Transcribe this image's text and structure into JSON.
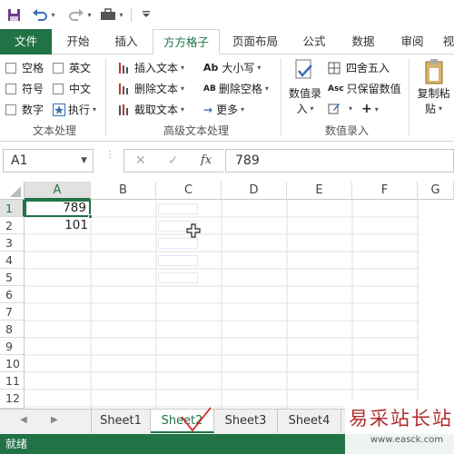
{
  "quick_access": {
    "save_icon": "save-icon",
    "undo_icon": "undo-icon",
    "redo_icon": "redo-icon",
    "custom_icon": "toolbox-icon",
    "dropdown_icon": "chevron-down-icon"
  },
  "tabs": [
    "文件",
    "开始",
    "插入",
    "方方格子",
    "页面布局",
    "公式",
    "数据",
    "审阅",
    "视"
  ],
  "ribbon": {
    "text_processing": {
      "label": "文本处理",
      "checkboxes": [
        "空格",
        "英文",
        "符号",
        "中文",
        "数字"
      ],
      "execute": "执行"
    },
    "advanced_text": {
      "label": "高级文本处理",
      "insert_text": "插入文本",
      "delete_text": "删除文本",
      "extract_text": "截取文本",
      "case": "大小写",
      "case_icon": "Ab",
      "delete_space": "删除空格",
      "delete_space_icon": "AB",
      "more": "更多"
    },
    "number_entry": {
      "label": "数值录入",
      "number_entry_btn": "数值录",
      "number_entry_btn2": "入",
      "round": "四舍五入",
      "keep_value": "只保留数值",
      "keep_value_icon": "Asc",
      "plus": "+"
    },
    "copy_paste": {
      "line1": "复制粘",
      "line2": "贴"
    }
  },
  "formula_bar": {
    "name_box": "A1",
    "cancel": "✕",
    "confirm": "✓",
    "fx": "fx",
    "value": "789"
  },
  "grid": {
    "columns": [
      "A",
      "B",
      "C",
      "D",
      "E",
      "F",
      "G"
    ],
    "rows": [
      "1",
      "2",
      "3",
      "4",
      "5",
      "6",
      "7",
      "8",
      "9",
      "10",
      "11",
      "12"
    ],
    "cells": {
      "A1": "789",
      "A2": "101"
    }
  },
  "sheets": [
    "Sheet1",
    "Sheet2",
    "Sheet3",
    "Sheet4"
  ],
  "active_sheet": "Sheet2",
  "status": "就绪",
  "watermark": {
    "title": "易采站长站",
    "url": "www.easck.com"
  },
  "colors": {
    "accent": "#217346",
    "pen": "#d9262c"
  }
}
